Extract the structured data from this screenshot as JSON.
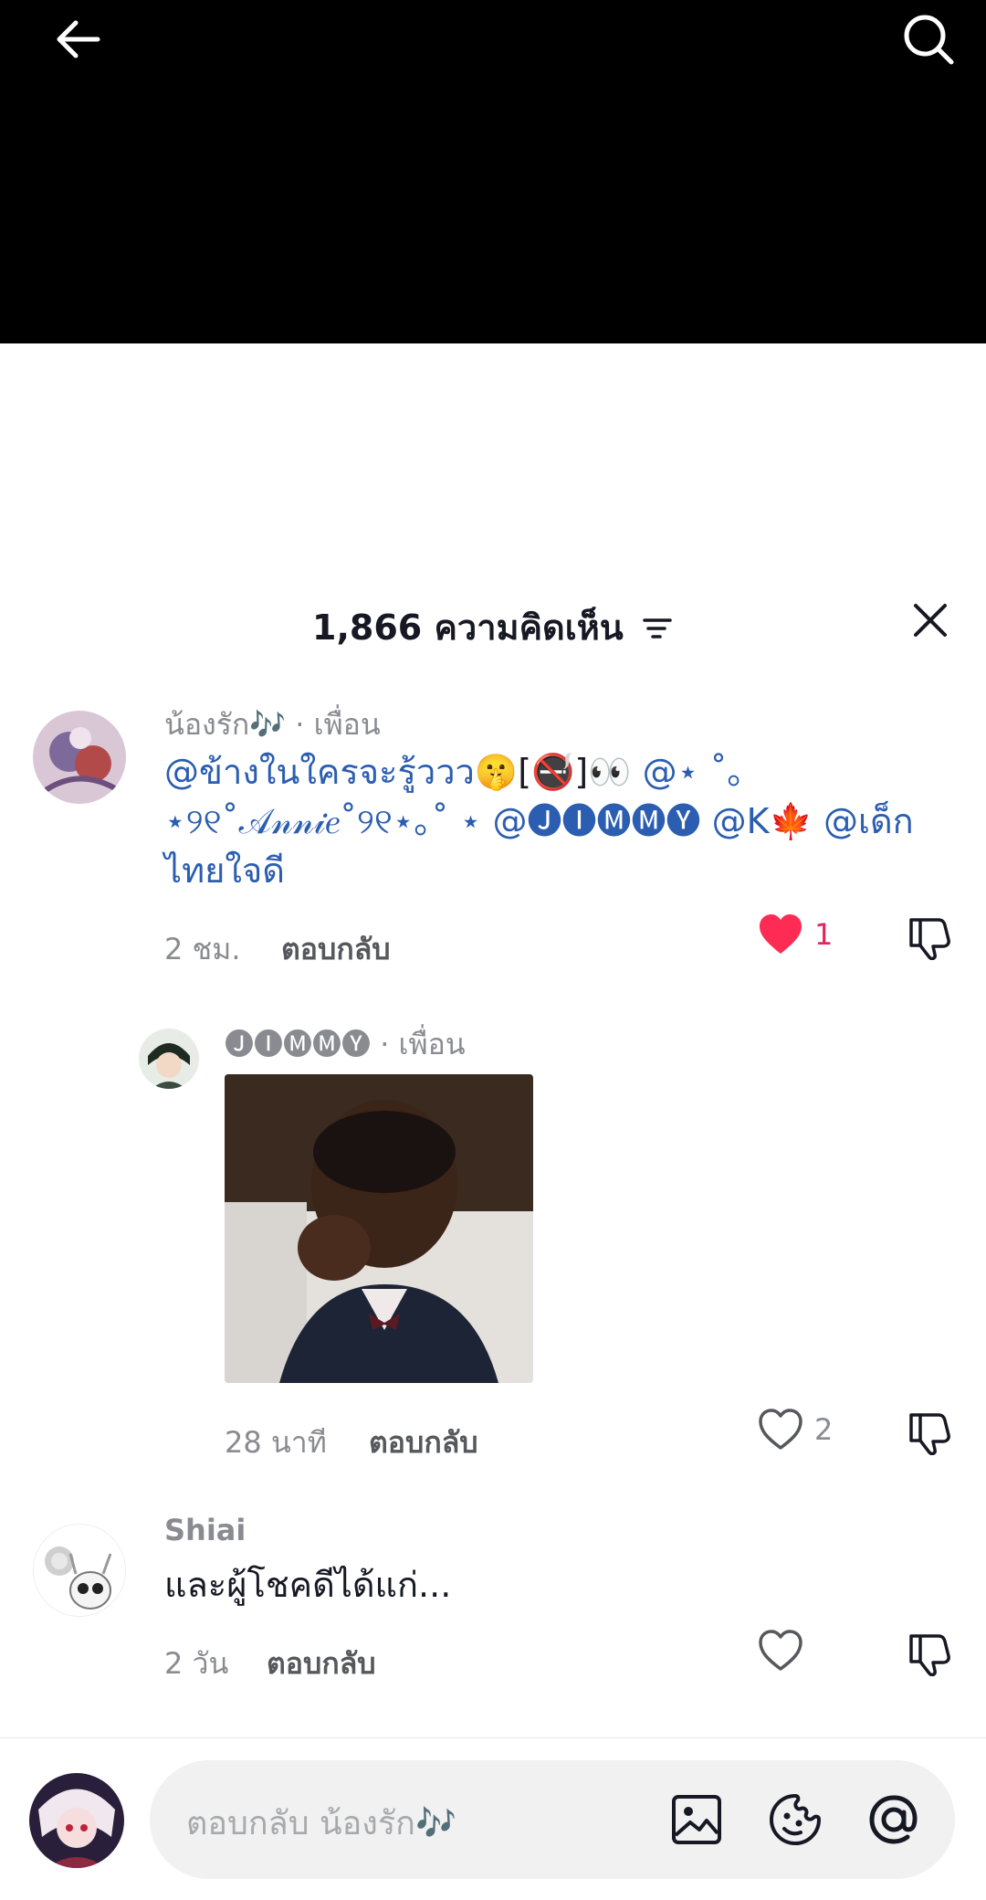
{
  "header": {
    "comment_count_title": "1,866 ความคิดเห็น"
  },
  "comments": [
    {
      "username": "น้องรัก🎶",
      "friend_label": "· เพื่อน",
      "text_mention_1": "@ข้างในใครจะรู้ววว",
      "text_rest_1": "🤫[🚭]👀",
      "text_mention_2": "@⋆ ˚｡⋆୨୧˚𝒜𝓃𝓃𝒾𝑒˚୨୧⋆｡˚ ⋆",
      "text_mention_3": "@🅙🅘🅜🅜🅨",
      "text_mention_4": "@K🍁",
      "text_mention_5": "@เด็กไทยใจดี",
      "time": "2 ชม.",
      "reply_label": "ตอบกลับ",
      "likes": "1",
      "liked": true
    },
    {
      "username": "🅙🅘🅜🅜🅨",
      "friend_label": "· เพื่อน",
      "time": "28 นาที",
      "reply_label": "ตอบกลับ",
      "likes": "2",
      "liked": false
    },
    {
      "username": "Shiai",
      "text": "และผู้โชคดีได้แก่...",
      "time": "2 วัน",
      "reply_label": "ตอบกลับ",
      "likes": "",
      "liked": false
    }
  ],
  "input": {
    "placeholder": "ตอบกลับ น้องรัก🎶"
  },
  "icons": {
    "back": "back-arrow-icon",
    "search": "search-icon",
    "sort": "sort-icon",
    "close": "close-icon",
    "like": "heart-icon",
    "dislike": "thumbs-down-icon",
    "image": "image-icon",
    "emoji": "emoji-icon",
    "mention": "at-icon"
  },
  "colors": {
    "like_active": "#fe2c55",
    "mention": "#2b5db0",
    "muted": "#8a8b91"
  }
}
